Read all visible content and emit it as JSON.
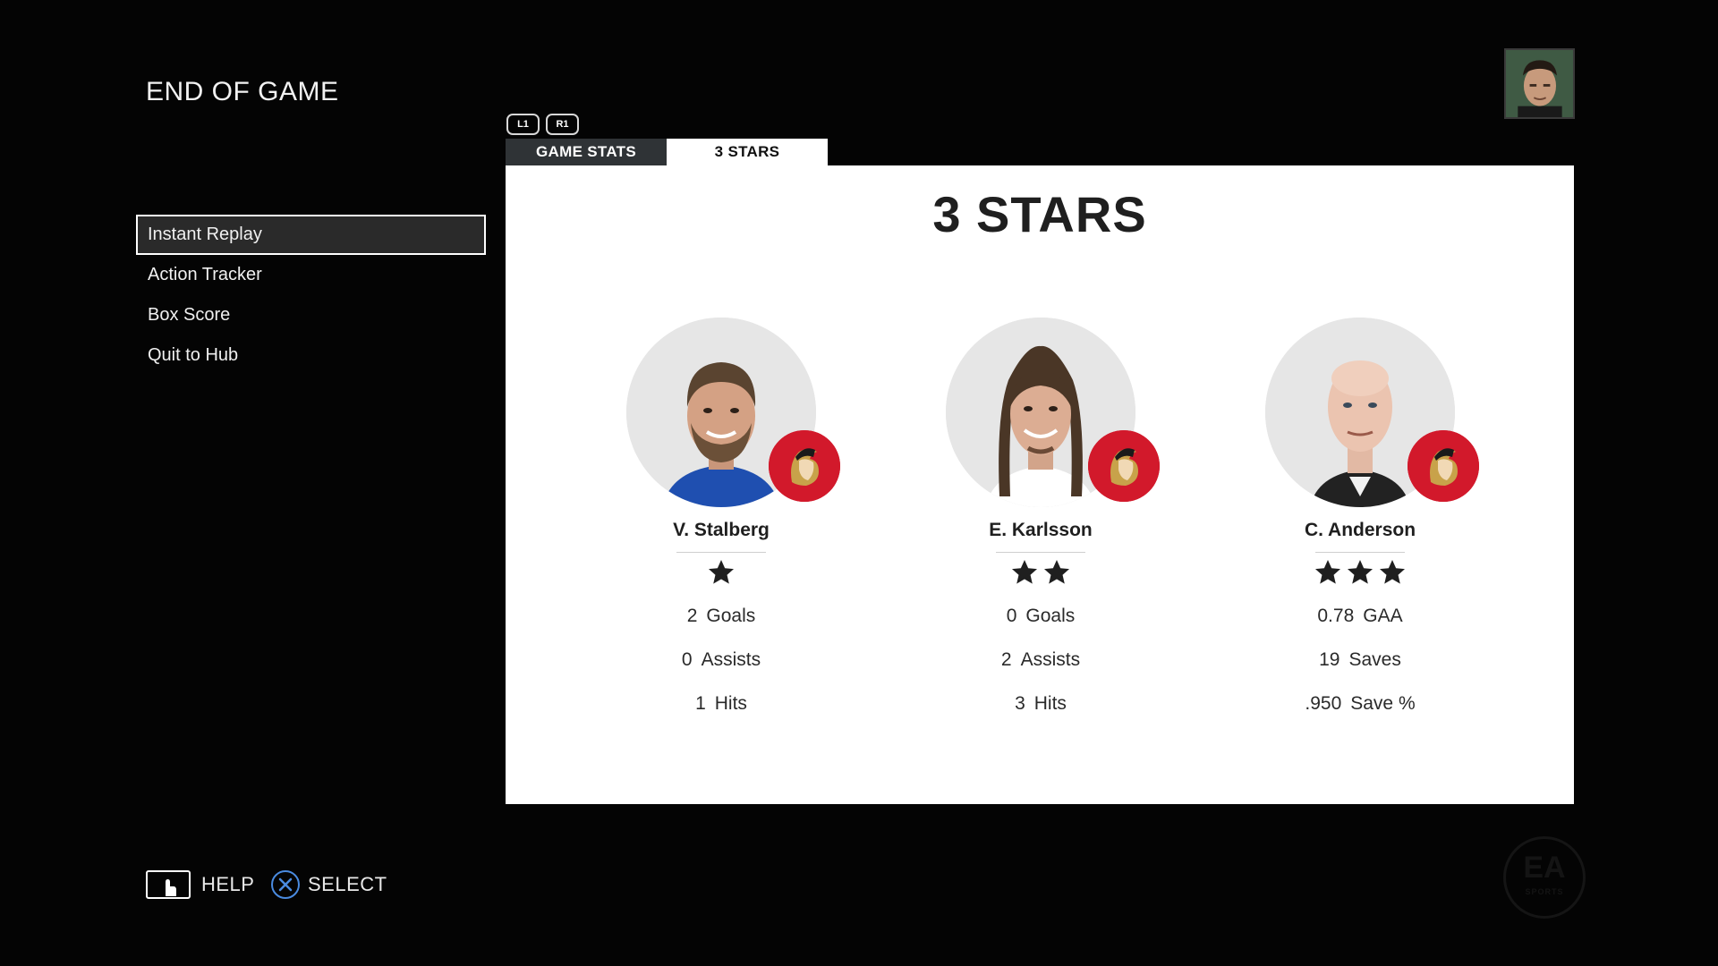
{
  "header": {
    "title": "END OF GAME"
  },
  "menu": {
    "items": [
      {
        "label": "Instant Replay",
        "selected": true
      },
      {
        "label": "Action Tracker",
        "selected": false
      },
      {
        "label": "Box Score",
        "selected": false
      },
      {
        "label": "Quit to Hub",
        "selected": false
      }
    ]
  },
  "shoulder_buttons": {
    "left": "L1",
    "right": "R1"
  },
  "tabs": [
    {
      "label": "GAME STATS",
      "active": false
    },
    {
      "label": "3 STARS",
      "active": true
    }
  ],
  "panel": {
    "title": "3 STARS",
    "players": [
      {
        "name": "V. Stalberg",
        "star_count": 1,
        "stats": [
          {
            "value": "2",
            "label": "Goals"
          },
          {
            "value": "0",
            "label": "Assists"
          },
          {
            "value": "1",
            "label": "Hits"
          }
        ]
      },
      {
        "name": "E. Karlsson",
        "star_count": 2,
        "stats": [
          {
            "value": "0",
            "label": "Goals"
          },
          {
            "value": "2",
            "label": "Assists"
          },
          {
            "value": "3",
            "label": "Hits"
          }
        ]
      },
      {
        "name": "C. Anderson",
        "star_count": 3,
        "stats": [
          {
            "value": "0.78",
            "label": "GAA"
          },
          {
            "value": "19",
            "label": "Saves"
          },
          {
            "value": ".950",
            "label": "Save %"
          }
        ]
      }
    ]
  },
  "footer": {
    "help_label": "HELP",
    "select_label": "SELECT",
    "help_icon": "touchpad-icon",
    "select_icon": "cross-button-icon"
  },
  "colors": {
    "background": "#040404",
    "panel": "#ffffff",
    "tab_inactive": "#2f3336",
    "team_red": "#d2192b",
    "cross_blue": "#4a8be0"
  }
}
